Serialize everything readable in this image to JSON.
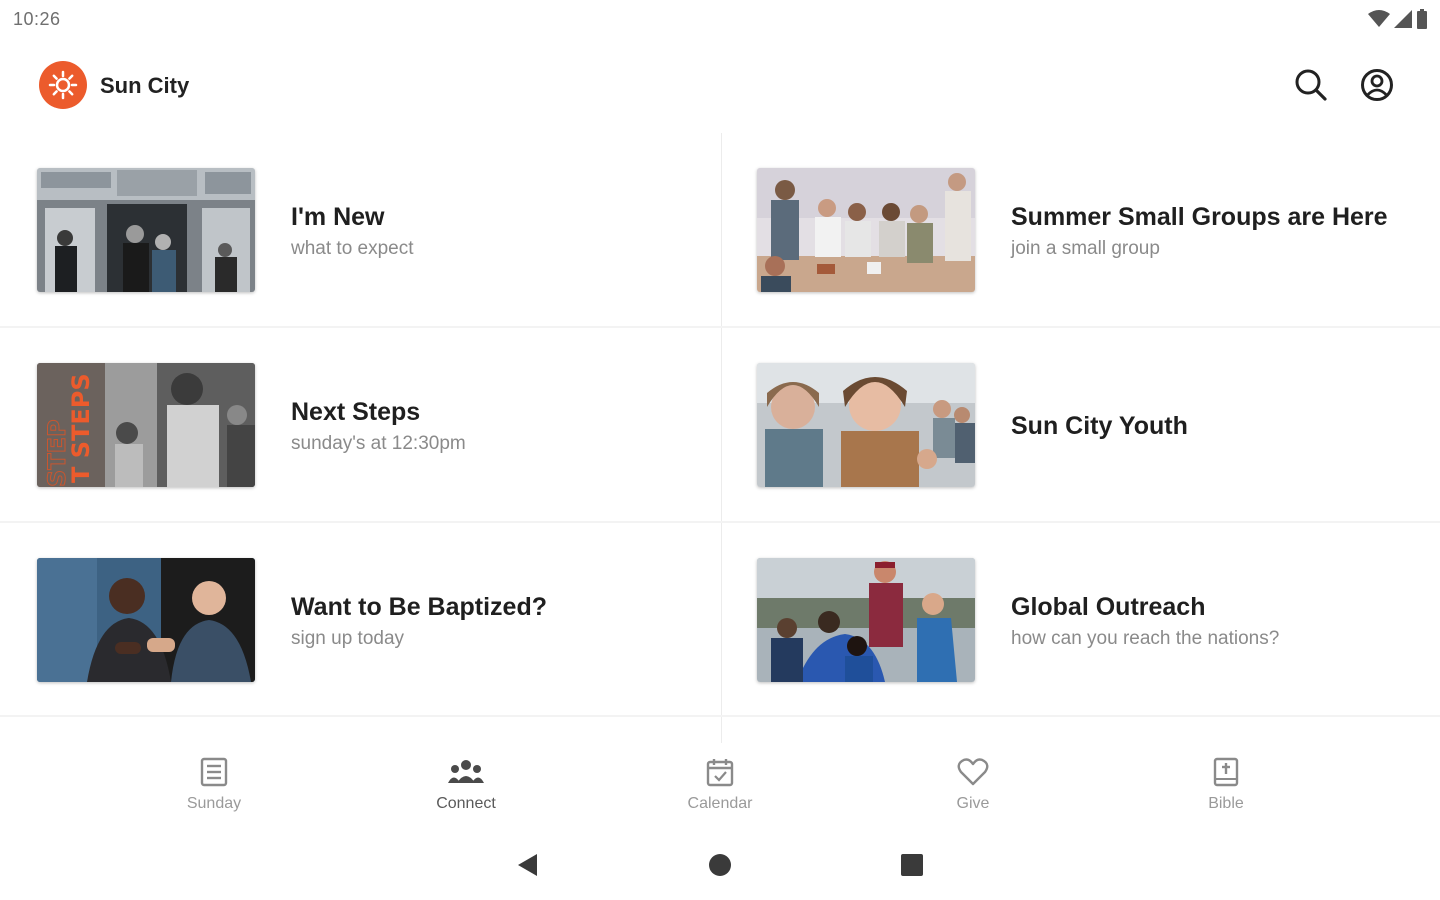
{
  "status": {
    "time": "10:26"
  },
  "app": {
    "title": "Sun City",
    "accent": "#ec5b2c",
    "logo_icon": "sun-icon",
    "search_icon": "search-icon",
    "account_icon": "account-circle-icon"
  },
  "cards": [
    {
      "title": "I'm New",
      "subtitle": "what to expect",
      "image": "welcome-entrance-photo"
    },
    {
      "title": "Summer Small Groups are Here",
      "subtitle": "join a small group",
      "image": "small-group-table-photo"
    },
    {
      "title": "Next Steps",
      "subtitle": "sunday's at 12:30pm",
      "image": "next-steps-photo",
      "image_text": "T STEPS"
    },
    {
      "title": "Sun City Youth",
      "subtitle": "",
      "image": "youth-selfie-photo"
    },
    {
      "title": "Want to Be Baptized?",
      "subtitle": "sign up today",
      "image": "baptism-laughing-photo"
    },
    {
      "title": "Global Outreach",
      "subtitle": "how can you reach the nations?",
      "image": "outreach-group-photo"
    }
  ],
  "bottom_nav": {
    "active": "Connect",
    "items": [
      {
        "label": "Sunday",
        "icon": "document-icon"
      },
      {
        "label": "Connect",
        "icon": "group-icon"
      },
      {
        "label": "Calendar",
        "icon": "calendar-icon"
      },
      {
        "label": "Give",
        "icon": "heart-icon"
      },
      {
        "label": "Bible",
        "icon": "bible-icon"
      }
    ]
  },
  "system_nav": [
    "back-icon",
    "home-icon",
    "recents-icon"
  ]
}
